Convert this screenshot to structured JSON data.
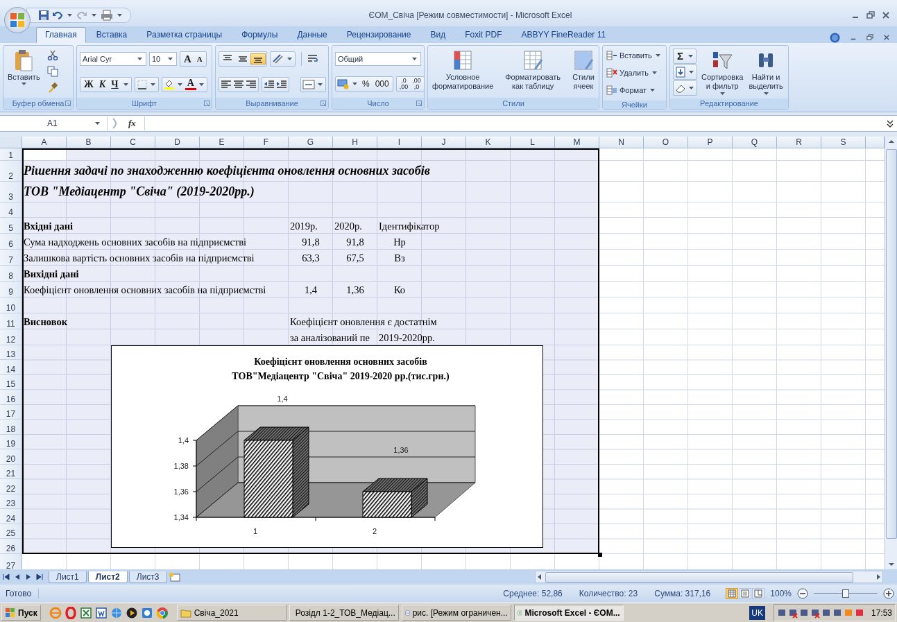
{
  "window": {
    "title": "ЄОМ_Свіча  [Режим совместимости] - Microsoft Excel"
  },
  "tabs": [
    {
      "label": "Главная",
      "selected": true
    },
    {
      "label": "Вставка",
      "selected": false
    },
    {
      "label": "Разметка страницы",
      "selected": false
    },
    {
      "label": "Формулы",
      "selected": false
    },
    {
      "label": "Данные",
      "selected": false
    },
    {
      "label": "Рецензирование",
      "selected": false
    },
    {
      "label": "Вид",
      "selected": false
    },
    {
      "label": "Foxit PDF",
      "selected": false
    },
    {
      "label": "ABBYY FineReader 11",
      "selected": false
    }
  ],
  "clipboard": {
    "paste": "Вставить",
    "group_label": "Буфер обмена"
  },
  "font": {
    "name": "Arial Cyr",
    "size": "10",
    "grow": "A",
    "shrink": "A",
    "bold": "Ж",
    "italic": "К",
    "underline": "Ч",
    "color_button": "A",
    "group_label": "Шрифт"
  },
  "alignment": {
    "vertical": [
      {
        "selected": false
      },
      {
        "selected": false
      },
      {
        "selected": true
      }
    ],
    "group_label": "Выравнивание"
  },
  "number": {
    "format": "Общий",
    "percent": "%",
    "thousands": "000",
    "decimals": [
      {
        "top": ",0",
        "bottom": ",00"
      },
      {
        "top": ",00",
        "bottom": ",0"
      }
    ],
    "group_label": "Число"
  },
  "styles": {
    "buttons": [
      {
        "lines": [
          "Условное",
          "форматирование"
        ]
      },
      {
        "lines": [
          "Форматировать",
          "как таблицу"
        ]
      },
      {
        "lines": [
          "Стили",
          "ячеек"
        ]
      }
    ],
    "group_label": "Стили"
  },
  "cells": {
    "buttons": [
      "Вставить",
      "Удалить",
      "Формат"
    ],
    "group_label": "Ячейки"
  },
  "editing": {
    "sum": "Σ",
    "sort": [
      "Сортировка",
      "и фильтр"
    ],
    "find": [
      "Найти и",
      "выделить"
    ],
    "group_label": "Редактирование"
  },
  "formula_bar": {
    "name_box": "A1",
    "function_label": "fx"
  },
  "sheet": {
    "columns": [
      "A",
      "B",
      "C",
      "D",
      "E",
      "F",
      "G",
      "H",
      "I",
      "J",
      "K",
      "L",
      "M",
      "N",
      "O",
      "P",
      "Q",
      "R",
      "S"
    ],
    "rows": [
      {
        "number": "1"
      },
      {
        "number": "2",
        "cells": {
          "A": {
            "kind": "title",
            "text": "Рішення задачі по знаходженню коефіцієнта оновлення основних засобів"
          }
        }
      },
      {
        "number": "3",
        "cells": {
          "A": {
            "kind": "title",
            "text": "ТОВ \"Медіацентр \"Свіча\" (2019-2020рр.)"
          }
        }
      },
      {
        "number": "4"
      },
      {
        "number": "5",
        "cells": {
          "A": {
            "kind": "heading",
            "text": "Вхідні дані"
          },
          "G": {
            "kind": "header",
            "text": "2019р."
          },
          "H": {
            "kind": "header",
            "text": "2020р."
          },
          "I": {
            "kind": "header",
            "text": "Ідентифікатор"
          }
        }
      },
      {
        "number": "6",
        "cells": {
          "A": {
            "kind": "text",
            "text": "Сума надходжень основних засобів на підприємстві"
          },
          "G": {
            "kind": "value",
            "text": "91,8"
          },
          "H": {
            "kind": "value",
            "text": "91,8"
          },
          "I": {
            "kind": "value",
            "text": "Нр"
          }
        }
      },
      {
        "number": "7",
        "cells": {
          "A": {
            "kind": "text",
            "text": "Залишкова вартість основних засобів на підприємстві"
          },
          "G": {
            "kind": "value",
            "text": "63,3"
          },
          "H": {
            "kind": "value",
            "text": "67,5"
          },
          "I": {
            "kind": "value",
            "text": "Вз"
          }
        }
      },
      {
        "number": "8",
        "cells": {
          "A": {
            "kind": "heading",
            "text": "Вихідні дані"
          }
        }
      },
      {
        "number": "9",
        "cells": {
          "A": {
            "kind": "text",
            "text": "Коефіцієнт оновлення основних засобів на підприємстві"
          },
          "G": {
            "kind": "value",
            "text": "1,4"
          },
          "H": {
            "kind": "value",
            "text": "1,36"
          },
          "I": {
            "kind": "value",
            "text": "Ко"
          }
        }
      },
      {
        "number": "10"
      },
      {
        "number": "11",
        "cells": {
          "A": {
            "kind": "heading",
            "text": "Висновок"
          },
          "G": {
            "kind": "note",
            "text": "Коефіцієнт оновлення є достатнім"
          }
        }
      },
      {
        "number": "12",
        "cells": {
          "G": {
            "kind": "note",
            "text": "за аналізований пе"
          },
          "I": {
            "kind": "note",
            "text": "2019-2020рр."
          }
        }
      },
      {
        "number": "13"
      },
      {
        "number": "14"
      },
      {
        "number": "15"
      },
      {
        "number": "16"
      },
      {
        "number": "17"
      },
      {
        "number": "18"
      },
      {
        "number": "19"
      },
      {
        "number": "20"
      },
      {
        "number": "21"
      },
      {
        "number": "22"
      },
      {
        "number": "23"
      },
      {
        "number": "24"
      },
      {
        "number": "25"
      },
      {
        "number": "26"
      },
      {
        "number": "27"
      }
    ],
    "chart": {
      "chart_data": {
        "type": "bar",
        "title": "Коефіцієнт оновлення основних засобів\nТОВ\"Медіацентр \"Свіча\" 2019-2020 рр.(тис.грн.)",
        "categories": [
          "1",
          "2"
        ],
        "series": [
          {
            "values": [
              1.4,
              1.36
            ]
          }
        ],
        "ylim": [
          1.34,
          1.4
        ],
        "yticks": [
          {
            "value": 1.34,
            "label": "1,34"
          },
          {
            "value": 1.36,
            "label": "1,36"
          },
          {
            "value": 1.38,
            "label": "1,38"
          },
          {
            "value": 1.4,
            "label": "1,4"
          }
        ],
        "value_labels": [
          "1,4",
          "1,36"
        ]
      }
    }
  },
  "sheet_tabs": [
    {
      "label": "Лист1",
      "selected": false
    },
    {
      "label": "Лист2",
      "selected": true
    },
    {
      "label": "Лист3",
      "selected": false
    }
  ],
  "status_bar": {
    "text": "Готово",
    "stats": [
      "Среднее: 52,86",
      "Количество: 23",
      "Сумма: 317,16"
    ],
    "views": [
      {
        "selected": true
      },
      {
        "selected": false
      },
      {
        "selected": false
      }
    ],
    "zoom": "100%",
    "zoom_slider": {
      "level": 0.5
    }
  },
  "taskbar": {
    "start": "Пуск",
    "tasks": [
      {
        "kind": "folder",
        "label": "Свіча_2021",
        "selected": false
      },
      {
        "kind": "document",
        "label": "Розідл 1-2_ТОВ_Медіац...",
        "selected": false
      },
      {
        "kind": "document",
        "label": "рис. [Режим ограничен...",
        "selected": false
      },
      {
        "kind": "spreadsheet",
        "label": "Microsoft Excel - ЄОМ...",
        "selected": true
      }
    ],
    "language": "UK",
    "clock": "17:53"
  }
}
